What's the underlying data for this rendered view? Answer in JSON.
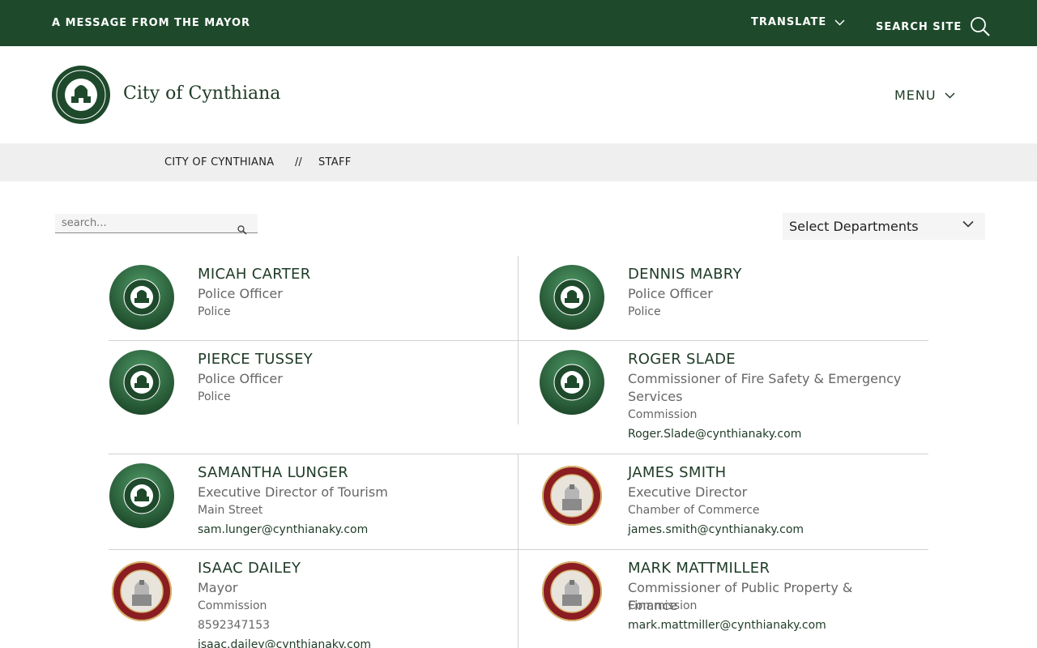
{
  "topbar": {
    "mayor_message": "A MESSAGE FROM THE MAYOR",
    "translate": "TRANSLATE",
    "search_site": "SEARCH SITE"
  },
  "header": {
    "site_title": "City of Cynthiana",
    "menu": "MENU"
  },
  "breadcrumb": {
    "home": "CITY OF CYNTHIANA",
    "separator": "//",
    "current": "STAFF"
  },
  "search": {
    "placeholder": "search..."
  },
  "department_select": {
    "selected": "Select Departments"
  },
  "staff": [
    {
      "name": "MICAH CARTER",
      "title": "Police Officer",
      "department": "Police",
      "contact": "",
      "contact2": "",
      "avatar": "green-seal"
    },
    {
      "name": "DENNIS MABRY",
      "title": "Police Officer",
      "department": "Police",
      "contact": "",
      "contact2": "",
      "avatar": "green-seal"
    },
    {
      "name": "PIERCE TUSSEY",
      "title": "Police Officer",
      "department": "Police",
      "contact": "",
      "contact2": "",
      "avatar": "green-seal"
    },
    {
      "name": "ROGER SLADE",
      "title": "Commissioner of Fire Safety & Emergency Services",
      "department": "Commission",
      "contact": "Roger.Slade@cynthianaky.com",
      "contact2": "",
      "avatar": "green-seal"
    },
    {
      "name": "SAMANTHA LUNGER",
      "title": "Executive Director of Tourism",
      "department": "Main Street",
      "contact": "sam.lunger@cynthianaky.com",
      "contact2": "",
      "avatar": "green-seal"
    },
    {
      "name": "JAMES SMITH",
      "title": "Executive Director",
      "department": "Chamber of Commerce",
      "contact": "james.smith@cynthianaky.com",
      "contact2": "",
      "avatar": "red-seal"
    },
    {
      "name": "ISAAC DAILEY",
      "title": "Mayor",
      "department": "Commission",
      "contact": "8592347153",
      "contact2": "isaac.dailey@cynthianaky.com",
      "avatar": "red-seal"
    },
    {
      "name": "MARK MATTMILLER",
      "title": "Commissioner of Public Property & Finance",
      "department": "Commission",
      "contact": "mark.mattmiller@cynthianaky.com",
      "contact2": "",
      "avatar": "red-seal"
    }
  ],
  "colors": {
    "brand_green": "#1e4a2b",
    "seal_red": "#8b1c22"
  }
}
